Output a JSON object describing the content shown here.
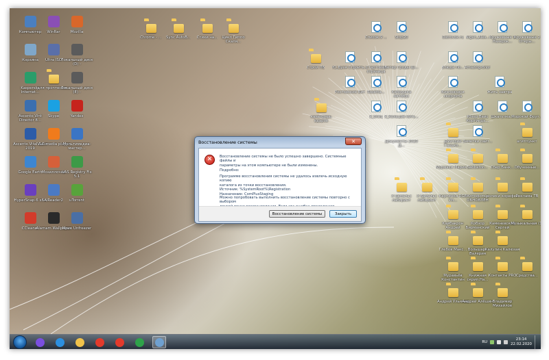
{
  "desktop": {
    "left_icons": [
      {
        "label": "Компьютер",
        "kind": "app",
        "color": "#4a7fc0"
      },
      {
        "label": "WinRar",
        "kind": "app",
        "color": "#8a4fb5"
      },
      {
        "label": "Mozilla",
        "kind": "app",
        "color": "#d9672a"
      },
      {
        "label": "Корзина",
        "kind": "app",
        "color": "#7fa7c9"
      },
      {
        "label": "Ultra ISO",
        "kind": "app",
        "color": "#5a6fa9"
      },
      {
        "label": "Локальный диск (D) -",
        "kind": "app",
        "color": "#5b5b5b"
      },
      {
        "label": "Kaspersky Internet...",
        "kind": "app",
        "color": "#2a9d6a"
      },
      {
        "label": "для прочтения...",
        "kind": "folder",
        "color": "#f0c24b"
      },
      {
        "label": "Локальный диск (E) -",
        "kind": "app",
        "color": "#5b5b5b"
      },
      {
        "label": "Ascento Vint Director 8...",
        "kind": "app",
        "color": "#3b6fb0"
      },
      {
        "label": "Skype",
        "kind": "app",
        "color": "#1ba1e2"
      },
      {
        "label": "Yandex",
        "kind": "app",
        "color": "#c6231c"
      },
      {
        "label": "Ascento Vital Boss 2019",
        "kind": "app",
        "color": "#2c5ca8"
      },
      {
        "label": "VLC media player",
        "kind": "app",
        "color": "#f07b1c"
      },
      {
        "label": "Мультимедиа-мастер...",
        "kind": "app",
        "color": "#3a75c4"
      },
      {
        "label": "Google Earth",
        "kind": "app",
        "color": "#3d86d1"
      },
      {
        "label": "Мозиллочка",
        "kind": "app",
        "color": "#d6603a"
      },
      {
        "label": "VAS Registry Fix 5.1",
        "kind": "app",
        "color": "#3d9a47"
      },
      {
        "label": "HyperSnap-6 x64",
        "kind": "app",
        "color": "#6a3fbf"
      },
      {
        "label": "AIReader2",
        "kind": "app",
        "color": "#4b7ac4"
      },
      {
        "label": "uTorrent",
        "kind": "app",
        "color": "#58a33b"
      },
      {
        "label": "CCleaner",
        "kind": "app",
        "color": "#d23c2b"
      },
      {
        "label": "Alamam Wallpaper",
        "kind": "app",
        "color": "#2a2a2a"
      },
      {
        "label": "Move Unfreezer",
        "kind": "app",
        "color": "#4a6fa5"
      }
    ],
    "top_row": [
      "Chrome - ...",
      "Sync AutoB...",
      "Стихи на...",
      "Цикл Гиппо Скаля...",
      "Список.9 ...",
      "Stop20",
      "Ostrovok.ru",
      "Nigen_Ales...",
      "Кружевные 1 Лазерок...",
      "Кружевные 2 Откры..."
    ],
    "mid_icons": [
      "Ю_Бузя Строить...",
      "Стартовая страница",
      "Ветер Гроды Ш...",
      "Строй ЛБ",
      "Блюда Ло...",
      "Amazing-блог",
      "Ростовские Бит",
      "Rosetta...",
      "Кабрушка Автобус",
      "Кисловодск скорлупа",
      "Жить завтра",
      "календарь вдаров",
      "Я_блиц",
      "Я_Кольцов нить...",
      "Юзер Вайс Кортиндэ...",
      "Шкатулка...",
      "Морской Фрут...",
      "Документы 2020 Д...",
      "Дмитрий Ганько...",
      "Заметки сайт...",
      "агитпункт"
    ],
    "right_folders": [
      "Мурмаси Мария...",
      "Sabbaton...",
      "Сбер Банк...",
      "Обученные...",
      "Х Бамальс лабиринт",
      "Х Бамальс лабиринт",
      "Картинки RGB Ум...",
      "Котофотка ОБНОВЛЁН",
      "ролики корефеи",
      "Реклама ТВ",
      "Кайбакрон Андрей",
      "Кобзор Бирманский",
      "Каменевский Сергей",
      "Музыкальная (1)",
      "Глебов Макс...",
      "Вольшарь Валерия",
      "Калупин Калюзая",
      "Муравьёв Константин",
      "Книжная скрип.На...",
      "Контакты PRO",
      "Средства...",
      "Андрей Ульянов",
      "Андрей Алёшин",
      "Владимир Михайлов"
    ]
  },
  "dialog": {
    "title": "Восстановление системы",
    "close_glyph": "✕",
    "error_glyph": "✕",
    "message1": "Восстановление системы не было успешно завершено. Системные файлы и\nпараметры на этом компьютере не были изменены.",
    "details_heading": "Подробно:",
    "details": "Программе восстановления системы не удалось извлечь исходную копию\nкаталога из точки восстановления.\n  Источник: %SystemRoot%\\Registration\n  Назначение: ComPlusStaging",
    "message2": "Можно попробовать выполнить восстановление системы повторно с выбором\nдругой точки восстановления. Если эта ошибка продолжает отображаться,\nможно попробовать использовать расширенный метод восстановления.",
    "btn_restore": "Восстановление системы",
    "btn_close": "Закрыть"
  },
  "taskbar": {
    "lang": "RU",
    "time": "23:14",
    "date": "22.02.2020",
    "pinned": [
      {
        "name": "alice",
        "color": "#7a4fe0"
      },
      {
        "name": "ie",
        "color": "#2c8fe0"
      },
      {
        "name": "explorer",
        "color": "#f0c24b"
      },
      {
        "name": "yandex-docs",
        "color": "#e23a2c"
      },
      {
        "name": "yandex-browser",
        "color": "#e23a2c"
      },
      {
        "name": "chrome",
        "color": "#2ea24a"
      },
      {
        "name": "system-restore",
        "color": "#6fa0d0"
      }
    ]
  }
}
